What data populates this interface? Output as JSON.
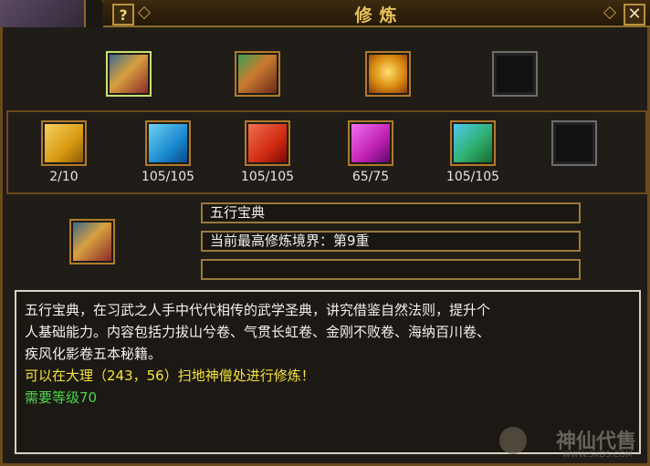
{
  "window": {
    "title": "修炼",
    "help_label": "?",
    "close_label": "✕"
  },
  "top_items": [
    {
      "icon": "book-stack-icon",
      "selected": true
    },
    {
      "icon": "scroll-bundle-icon",
      "selected": false
    },
    {
      "icon": "treasure-chest-icon",
      "selected": false
    },
    {
      "icon": "empty-slot",
      "selected": false
    }
  ],
  "books": [
    {
      "icon": "yellow-book-icon",
      "count": "2/10",
      "color": "#e0a020"
    },
    {
      "icon": "blue-book-icon",
      "count": "105/105",
      "color": "#2a9ad8"
    },
    {
      "icon": "red-book-icon",
      "count": "105/105",
      "color": "#d83020"
    },
    {
      "icon": "purple-book-icon",
      "count": "65/75",
      "color": "#c030c0"
    },
    {
      "icon": "green-book-icon",
      "count": "105/105",
      "color": "#30b060"
    },
    {
      "icon": "empty-slot",
      "count": "",
      "color": ""
    }
  ],
  "detail": {
    "name": "五行宝典",
    "realm": "当前最高修炼境界：第9重",
    "extra": ""
  },
  "description": {
    "line1": "五行宝典，在习武之人手中代代相传的武学圣典，讲究借鉴自然法则，提升个",
    "line2": "人基础能力。内容包括力拔山兮卷、气贯长虹卷、金刚不败卷、海纳百川卷、",
    "line3": "疾风化影卷五本秘籍。",
    "location": "可以在大理（243，56）扫地神僧处进行修炼！",
    "level": "需要等级70"
  },
  "watermark": {
    "text": "神仙代售",
    "sub": "WWW.SXDS.COM"
  }
}
